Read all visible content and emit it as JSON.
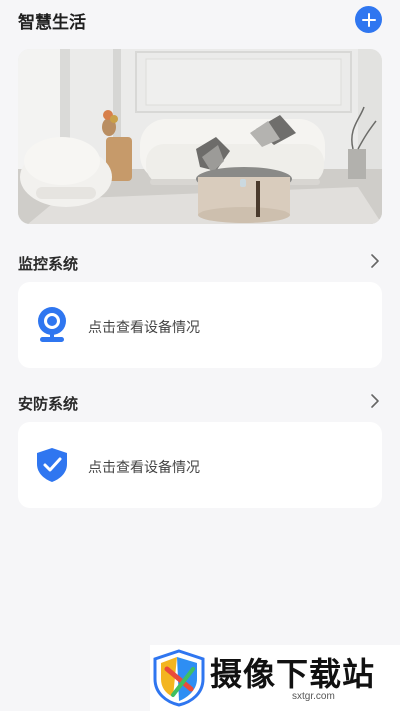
{
  "header": {
    "title": "智慧生活",
    "add_icon": "plus-icon",
    "accent_color": "#2f76f0"
  },
  "banner": {
    "image_desc": "living-room-photo"
  },
  "sections": [
    {
      "title": "监控系统",
      "chevron_icon": "chevron-right-icon",
      "card": {
        "icon": "camera-icon",
        "text": "点击查看设备情况"
      }
    },
    {
      "title": "安防系统",
      "chevron_icon": "chevron-right-icon",
      "card": {
        "icon": "shield-check-icon",
        "text": "点击查看设备情况"
      }
    }
  ],
  "watermark": {
    "text": "摄像下载站",
    "url": "sxtgr.com"
  }
}
